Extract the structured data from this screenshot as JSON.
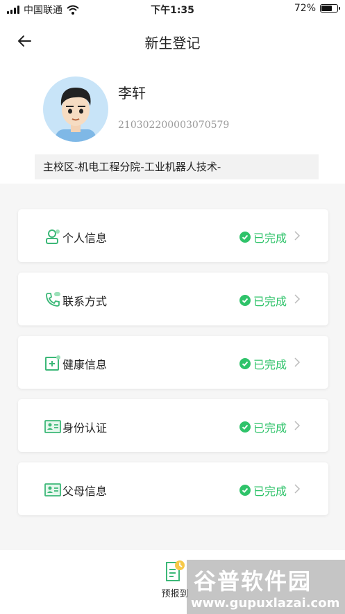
{
  "status_bar": {
    "carrier": "中国联通",
    "time": "下午1:35",
    "battery": "72%",
    "battery_level": 0.72
  },
  "nav": {
    "title": "新生登记"
  },
  "profile": {
    "name": "李轩",
    "student_id": "210302200003070579",
    "department": "主校区-机电工程分院-工业机器人技术-"
  },
  "cards": [
    {
      "label": "个人信息",
      "status": "已完成",
      "icon": "person-icon"
    },
    {
      "label": "联系方式",
      "status": "已完成",
      "icon": "phone-icon"
    },
    {
      "label": "健康信息",
      "status": "已完成",
      "icon": "health-icon"
    },
    {
      "label": "身份认证",
      "status": "已完成",
      "icon": "id-card-icon"
    },
    {
      "label": "父母信息",
      "status": "已完成",
      "icon": "id-card-icon"
    }
  ],
  "bottom": {
    "prereport_label": "预报到"
  },
  "watermark": {
    "main": "谷普软件园",
    "sub": "www.gupuxlazai.com"
  },
  "colors": {
    "accent": "#2fc36a",
    "icon_green": "#3cb878",
    "section_bg": "#f6f6f6"
  }
}
